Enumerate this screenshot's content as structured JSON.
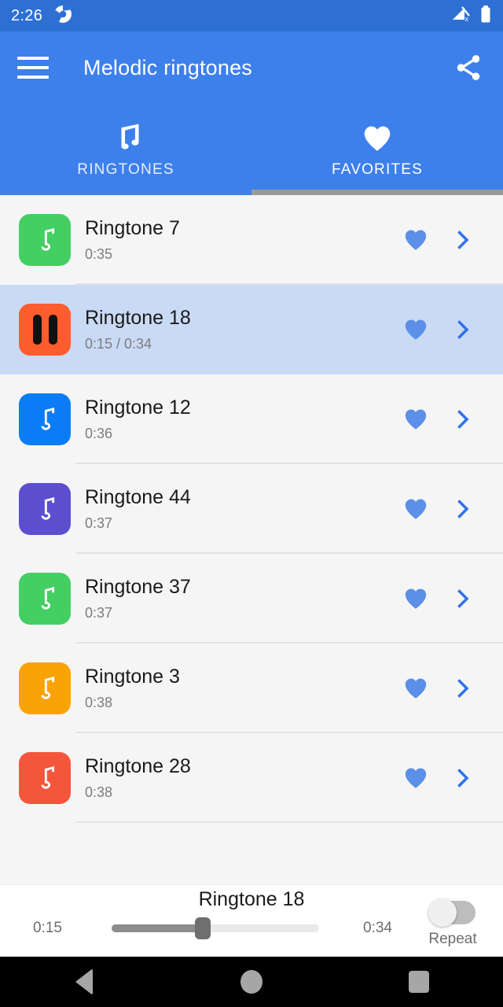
{
  "status_bar": {
    "time": "2:26",
    "icons": [
      "chrome-icon",
      "no-signal-icon",
      "battery-full-icon"
    ]
  },
  "toolbar": {
    "menu_icon": "hamburger-menu-icon",
    "title": "Melodic ringtones",
    "share_icon": "share-icon"
  },
  "tabs": {
    "items": [
      {
        "label": "RINGTONES",
        "icon": "music-note-icon",
        "selected": false
      },
      {
        "label": "FAVORITES",
        "icon": "heart-icon",
        "selected": true
      }
    ],
    "indicator_color": "#9a9a9a"
  },
  "list": {
    "rows": [
      {
        "title": "Ringtone 7",
        "duration": "0:35",
        "thumb_color": "#44cf62",
        "thumb_icon": "music-note-icon",
        "playing": false,
        "favorite": true
      },
      {
        "title": "Ringtone 18",
        "duration": "0:15 /  0:34",
        "thumb_color": "#ff5d2e",
        "thumb_icon": "pause-icon",
        "playing": true,
        "favorite": true
      },
      {
        "title": "Ringtone 12",
        "duration": "0:36",
        "thumb_color": "#0a7cf5",
        "thumb_icon": "music-note-icon",
        "playing": false,
        "favorite": true
      },
      {
        "title": "Ringtone 44",
        "duration": "0:37",
        "thumb_color": "#5b4fd0",
        "thumb_icon": "music-note-icon",
        "playing": false,
        "favorite": true
      },
      {
        "title": "Ringtone 37",
        "duration": "0:37",
        "thumb_color": "#44cf62",
        "thumb_icon": "music-note-icon",
        "playing": false,
        "favorite": true
      },
      {
        "title": "Ringtone 3",
        "duration": "0:38",
        "thumb_color": "#faa307",
        "thumb_icon": "music-note-icon",
        "playing": false,
        "favorite": true
      },
      {
        "title": "Ringtone 28",
        "duration": "0:38",
        "thumb_color": "#f4563c",
        "thumb_icon": "music-note-icon",
        "playing": false,
        "favorite": true
      }
    ],
    "heart_color": "#5b8fe8",
    "chevron_color": "#2f72e8",
    "playing_row_bg": "#c9daf5"
  },
  "player": {
    "title": "Ringtone 18",
    "current_time": "0:15",
    "total_time": "0:34",
    "progress_percent": 44,
    "repeat_label": "Repeat",
    "repeat_on": false
  },
  "nav_bar": {
    "back_icon": "back-triangle-icon",
    "home_icon": "home-circle-icon",
    "recents_icon": "recents-square-icon"
  },
  "colors": {
    "status_bar": "#2e6fd4",
    "toolbar": "#3d80ec",
    "page_bg": "#f5f5f5"
  }
}
